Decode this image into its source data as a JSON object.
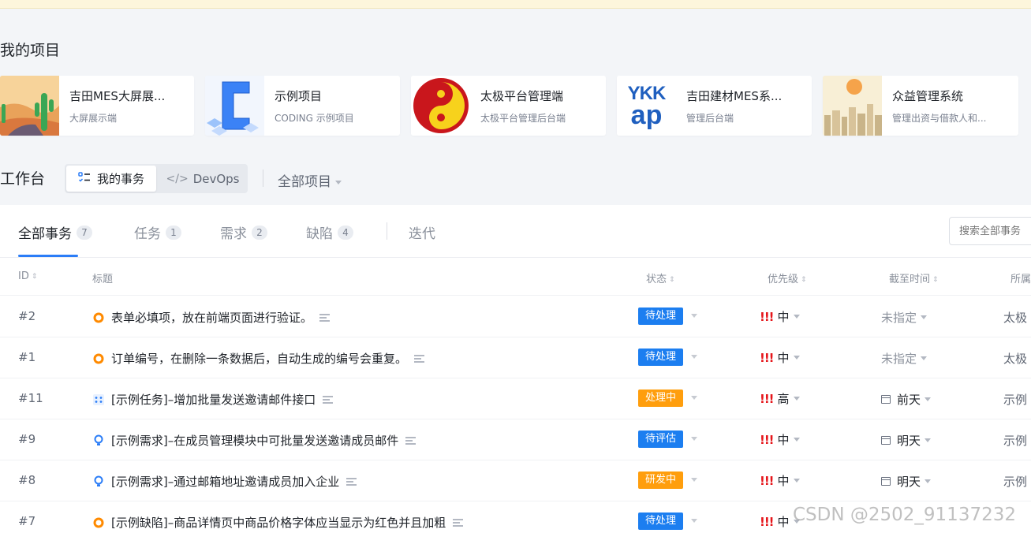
{
  "section_title": "我的项目",
  "projects": [
    {
      "name": "吉田MES大屏展...",
      "desc": "大屏展示端"
    },
    {
      "name": "示例项目",
      "desc": "CODING 示例项目"
    },
    {
      "name": "太极平台管理端",
      "desc": "太极平台管理后台端"
    },
    {
      "name": "吉田建材MES系...",
      "desc": "管理后台端",
      "logo_text_top": "YKK",
      "logo_text_bottom": "ap"
    },
    {
      "name": "众益管理系统",
      "desc": "管理出资与借款人和..."
    }
  ],
  "workbench": {
    "title": "工作台",
    "seg_active": "我的事务",
    "seg_other": "DevOps",
    "all_projects": "全部项目"
  },
  "tabs": [
    {
      "label": "全部事务",
      "count": "7"
    },
    {
      "label": "任务",
      "count": "1"
    },
    {
      "label": "需求",
      "count": "2"
    },
    {
      "label": "缺陷",
      "count": "4"
    },
    {
      "label": "迭代"
    }
  ],
  "search_placeholder": "搜索全部事务",
  "columns": {
    "id": "ID",
    "title": "标题",
    "status": "状态",
    "priority": "优先级",
    "due": "截至时间",
    "owner": "所属"
  },
  "rows": [
    {
      "id": "#2",
      "type": "defect",
      "title": "表单必填项，放在前端页面进行验证。",
      "status": "待处理",
      "status_color": "#1c7ef0",
      "priority_mark": "!!!",
      "priority": "中",
      "due": "未指定",
      "due_set": false,
      "owner": "太极"
    },
    {
      "id": "#1",
      "type": "defect",
      "title": "订单编号，在删除一条数据后，自动生成的编号会重复。",
      "status": "待处理",
      "status_color": "#1c7ef0",
      "priority_mark": "!!!",
      "priority": "中",
      "due": "未指定",
      "due_set": false,
      "owner": "太极"
    },
    {
      "id": "#11",
      "type": "task",
      "title": "[示例任务]–增加批量发送邀请邮件接口",
      "status": "处理中",
      "status_color": "#ff9e0d",
      "priority_mark": "!!!",
      "priority": "高",
      "due": "前天",
      "due_set": true,
      "owner": "示例"
    },
    {
      "id": "#9",
      "type": "requirement",
      "title": "[示例需求]–在成员管理模块中可批量发送邀请成员邮件",
      "status": "待评估",
      "status_color": "#1c7ef0",
      "priority_mark": "!!!",
      "priority": "中",
      "due": "明天",
      "due_set": true,
      "owner": "示例"
    },
    {
      "id": "#8",
      "type": "requirement",
      "title": "[示例需求]–通过邮箱地址邀请成员加入企业",
      "status": "研发中",
      "status_color": "#ff9e0d",
      "priority_mark": "!!!",
      "priority": "中",
      "due": "明天",
      "due_set": true,
      "owner": "示例"
    },
    {
      "id": "#7",
      "type": "defect",
      "title": "[示例缺陷]–商品详情页中商品价格字体应当显示为红色并且加粗",
      "status": "待处理",
      "status_color": "#1c7ef0",
      "priority_mark": "!!!",
      "priority": "中",
      "due": "",
      "due_set": false,
      "owner": ""
    }
  ],
  "watermark": "CSDN @2502_91137232"
}
